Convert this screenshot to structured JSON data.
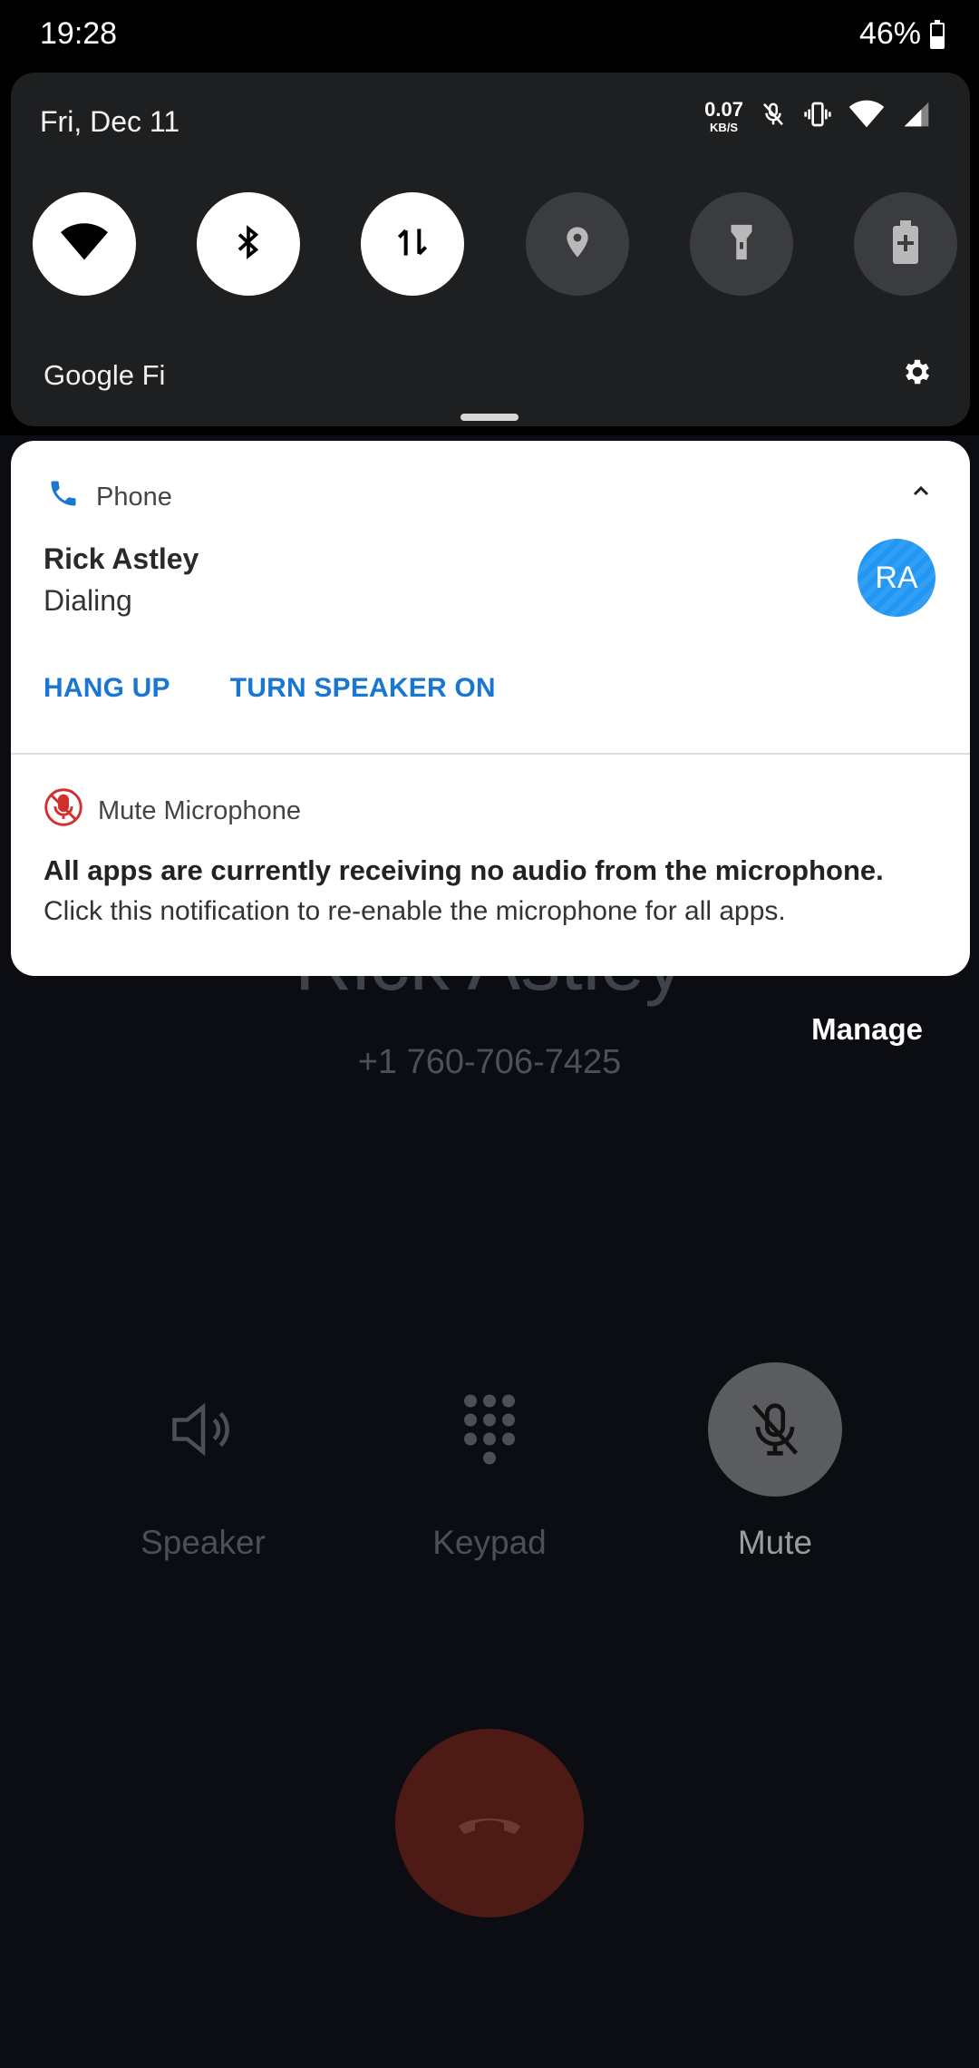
{
  "status_bar": {
    "time": "19:28",
    "battery": "46%",
    "battery_level": 0.46
  },
  "quick_settings": {
    "date": "Fri, Dec 11",
    "net_speed_value": "0.07",
    "net_speed_unit": "KB/S",
    "status_icons": [
      "mic-off-icon",
      "vibrate-icon",
      "wifi-icon",
      "cell-signal-icon"
    ],
    "tiles": [
      {
        "name": "wifi",
        "icon": "wifi-icon",
        "on": true
      },
      {
        "name": "bluetooth",
        "icon": "bluetooth-icon",
        "on": true
      },
      {
        "name": "mobile-data",
        "icon": "data-arrows-icon",
        "on": true
      },
      {
        "name": "location",
        "icon": "location-pin-icon",
        "on": false
      },
      {
        "name": "flashlight",
        "icon": "flashlight-icon",
        "on": false
      },
      {
        "name": "battery-saver",
        "icon": "battery-saver-icon",
        "on": false
      }
    ],
    "carrier": "Google Fi"
  },
  "notification_phone": {
    "app": "Phone",
    "title": "Rick Astley",
    "subtitle": "Dialing",
    "avatar_initials": "RA",
    "actions": [
      "HANG UP",
      "TURN SPEAKER ON"
    ],
    "accent_color": "#1976d2"
  },
  "notification_mic": {
    "app": "Mute Microphone",
    "title": "All apps are currently receiving no audio from the microphone.",
    "body": "Click this notification to re-enable the microphone for all apps.",
    "icon_color": "#d32f2f"
  },
  "call_screen": {
    "contact_name": "Rick Astley",
    "number": "+1 760-706-7425",
    "manage": "Manage",
    "controls": [
      {
        "label": "Speaker",
        "icon": "speaker-icon",
        "active": false
      },
      {
        "label": "Keypad",
        "icon": "keypad-icon",
        "active": false
      },
      {
        "label": "Mute",
        "icon": "mic-off-icon",
        "active": true
      }
    ],
    "hangup_color": "#4e1a15"
  }
}
